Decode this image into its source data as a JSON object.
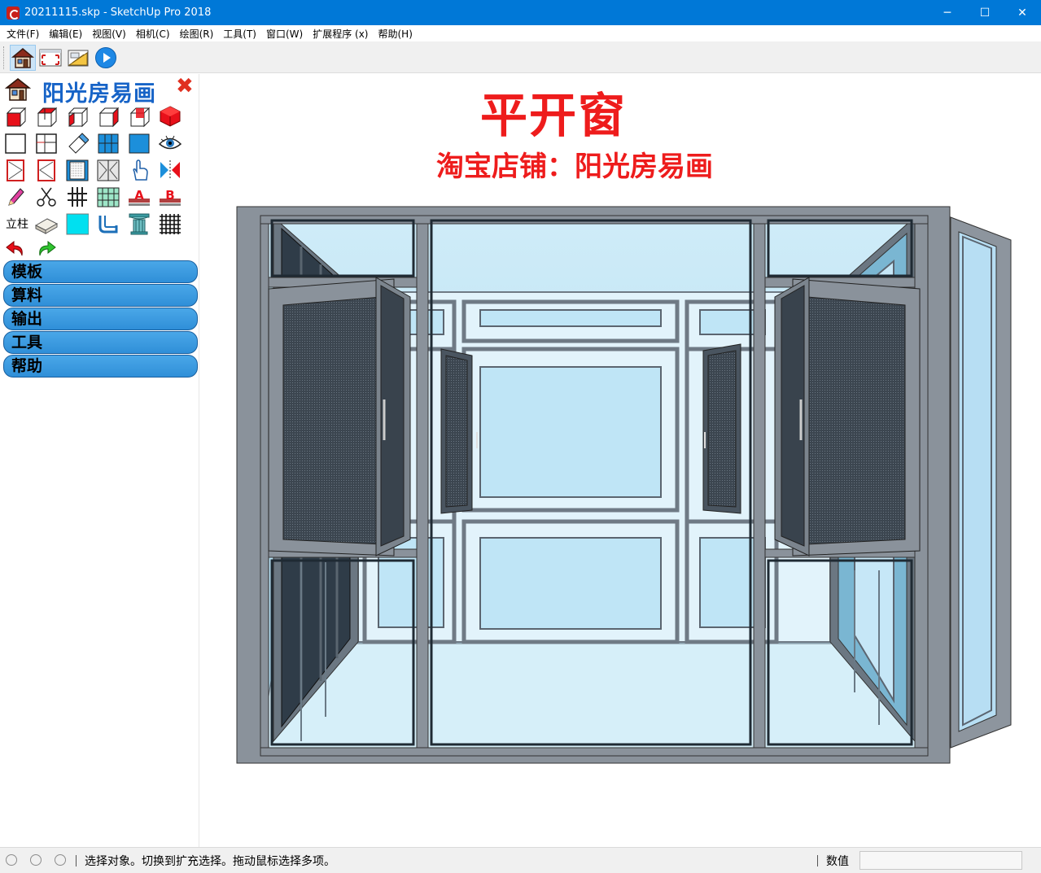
{
  "window": {
    "title": "20211115.skp - SketchUp Pro 2018",
    "minimize_glyph": "─",
    "maximize_glyph": "☐",
    "close_glyph": "✕"
  },
  "menu": [
    {
      "label": "文件(F)"
    },
    {
      "label": "编辑(E)"
    },
    {
      "label": "视图(V)"
    },
    {
      "label": "相机(C)"
    },
    {
      "label": "绘图(R)"
    },
    {
      "label": "工具(T)"
    },
    {
      "label": "窗口(W)"
    },
    {
      "label": "扩展程序 (x)"
    },
    {
      "label": "帮助(H)"
    }
  ],
  "toolbar": {
    "icons": [
      "house-icon",
      "zoom-extents-icon",
      "layout-icon",
      "play-icon"
    ]
  },
  "panel": {
    "title": "阳光房易画",
    "close_glyph": "✖",
    "column_label": "立柱",
    "sections": [
      {
        "label": "模板"
      },
      {
        "label": "算料"
      },
      {
        "label": "输出"
      },
      {
        "label": "工具"
      },
      {
        "label": "帮助"
      }
    ]
  },
  "viewport": {
    "title": "平开窗",
    "subtitle": "淘宝店铺：阳光房易画"
  },
  "status": {
    "message": "选择对象。切换到扩充选择。拖动鼠标选择多项。",
    "value_label": "数值",
    "value": ""
  },
  "colors": {
    "titlebar": "#0078d7",
    "accent_red": "#ee1c1c",
    "panel_title": "#1663c7",
    "section_button": "#3a9be0",
    "frame_gray": "#7d8590",
    "glass_blue": "#bfe4f5"
  }
}
